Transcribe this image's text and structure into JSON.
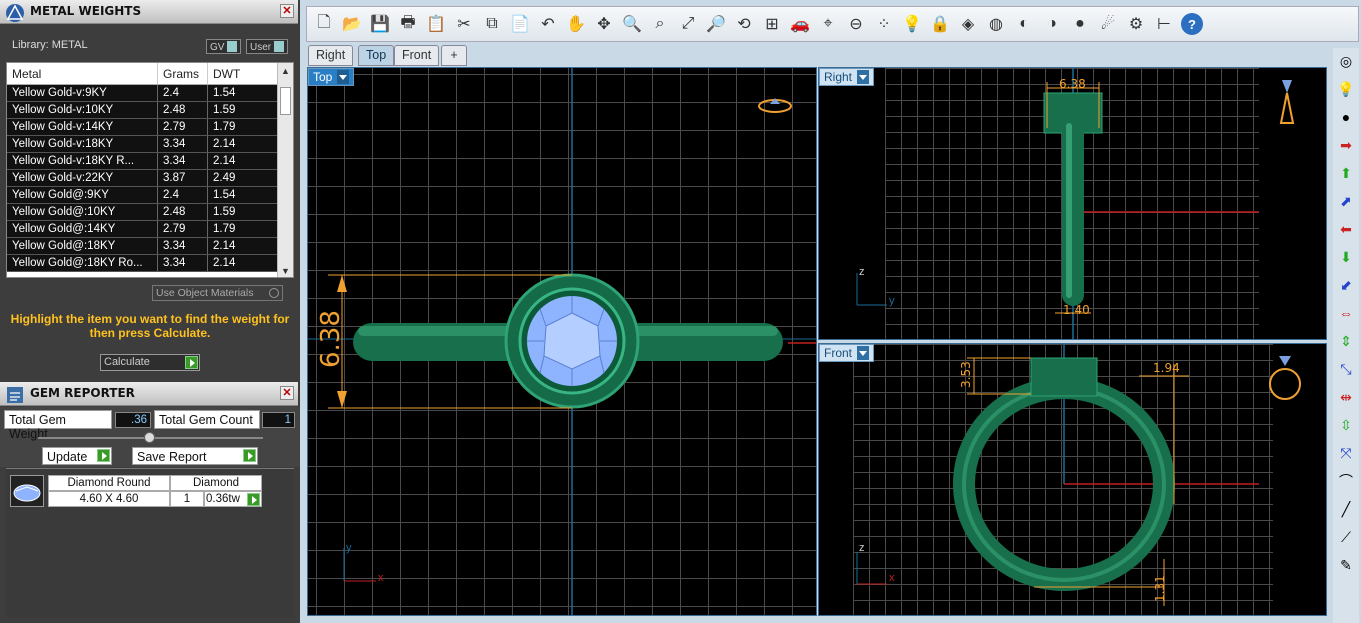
{
  "metal_panel": {
    "title": "METAL WEIGHTS",
    "library_label": "Library: METAL",
    "toggle_gv": "GV",
    "toggle_user": "User",
    "columns": [
      "Metal",
      "Grams",
      "DWT"
    ],
    "rows": [
      [
        "Yellow Gold-v:9KY",
        "2.4",
        "1.54"
      ],
      [
        "Yellow Gold-v:10KY",
        "2.48",
        "1.59"
      ],
      [
        "Yellow Gold-v:14KY",
        "2.79",
        "1.79"
      ],
      [
        "Yellow Gold-v:18KY",
        "3.34",
        "2.14"
      ],
      [
        "Yellow Gold-v:18KY R...",
        "3.34",
        "2.14"
      ],
      [
        "Yellow Gold-v:22KY",
        "3.87",
        "2.49"
      ],
      [
        "Yellow Gold@:9KY",
        "2.4",
        "1.54"
      ],
      [
        "Yellow Gold@:10KY",
        "2.48",
        "1.59"
      ],
      [
        "Yellow Gold@:14KY",
        "2.79",
        "1.79"
      ],
      [
        "Yellow Gold@:18KY",
        "3.34",
        "2.14"
      ],
      [
        "Yellow Gold@:18KY Ro...",
        "3.34",
        "2.14"
      ]
    ],
    "use_object_materials": "Use Object Materials",
    "hint": "Highlight the item you want to find the weight for then press Calculate.",
    "calculate_label": "Calculate"
  },
  "gem_panel": {
    "title": "GEM REPORTER",
    "total_weight_label": "Total Gem Weight",
    "total_weight_value": ".36",
    "total_count_label": "Total Gem Count",
    "total_count_value": "1",
    "update_label": "Update",
    "save_report_label": "Save Report",
    "gem": {
      "shape": "Diamond Round",
      "type": "Diamond",
      "size": "4.60 X 4.60",
      "count": "1",
      "weight": "0.36tw"
    }
  },
  "tabs": [
    "Right",
    "Top",
    "Front"
  ],
  "active_tab": "Top",
  "viewports": {
    "top": {
      "label": "Top",
      "dim": "6.38",
      "axis_v": "y",
      "axis_h": "x"
    },
    "right": {
      "label": "Right",
      "dim_top": "6.38",
      "dim_bottom": "1.40",
      "axis_v": "z",
      "axis_h": "y"
    },
    "front": {
      "label": "Front",
      "dim_left": "3.53",
      "dim_right": "1.94",
      "dim_bottom": "1.31",
      "axis_v": "z",
      "axis_h": "x"
    }
  },
  "colors": {
    "ring": "#1e7a55",
    "dimension": "#f0a030",
    "gem": "#8fb4ff",
    "accent": "#2a7fc4"
  }
}
